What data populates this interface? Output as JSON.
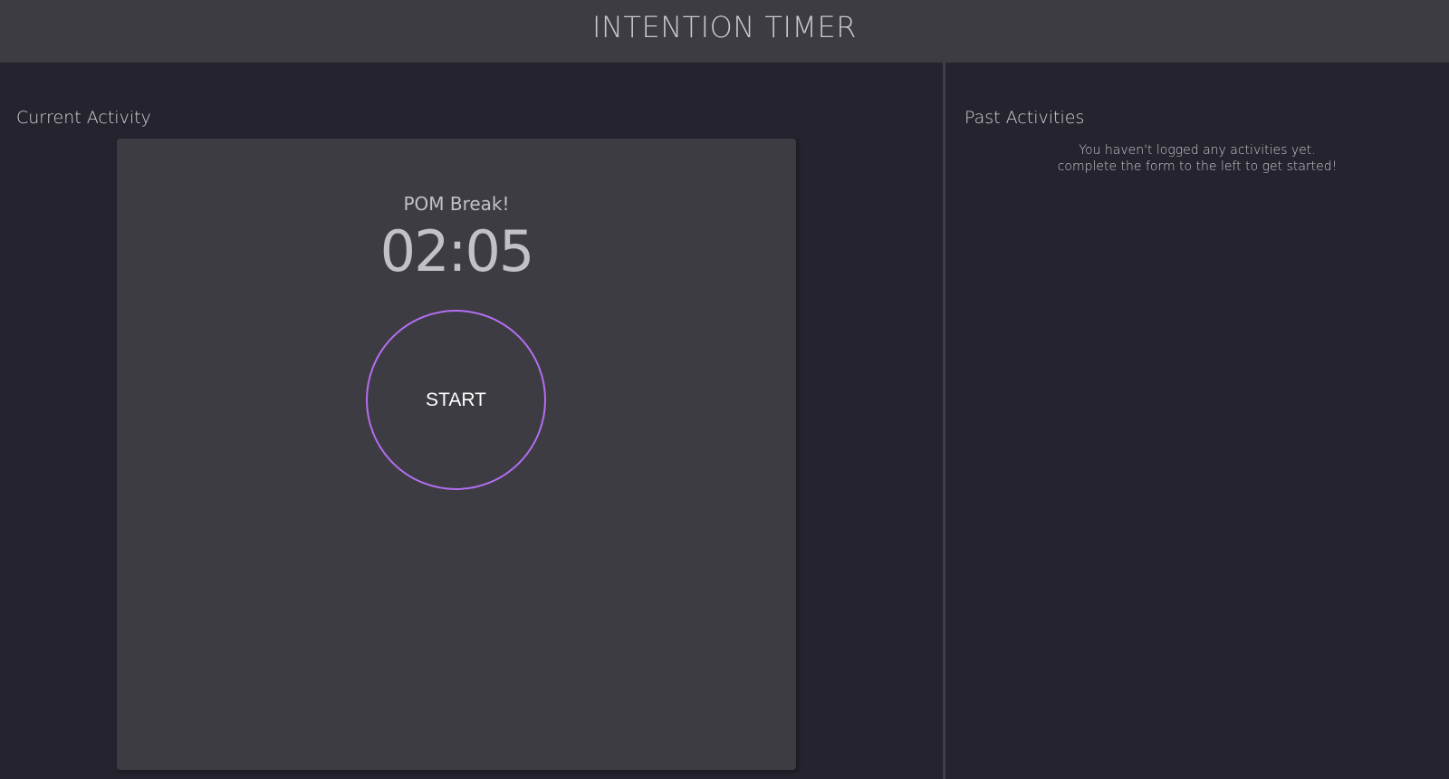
{
  "header": {
    "title": "INTENTION TIMER"
  },
  "current": {
    "title": "Current Activity",
    "activity_label": "POM Break!",
    "time": "02:05",
    "start_label": "START"
  },
  "past": {
    "title": "Past Activities",
    "empty_line1": "You haven't logged any activities yet.",
    "empty_line2": "complete the form to the left to get started!"
  },
  "colors": {
    "accent": "#b36ef0",
    "background": "#25232d",
    "panel": "#3e3c43"
  }
}
